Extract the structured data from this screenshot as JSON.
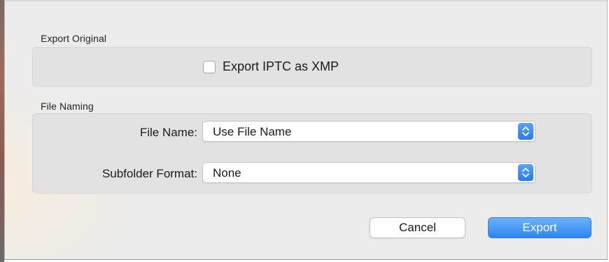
{
  "export_original": {
    "section_title": "Export Original",
    "iptc_checkbox_label": "Export IPTC as XMP",
    "iptc_checked": false
  },
  "file_naming": {
    "section_title": "File Naming",
    "file_name_label": "File Name:",
    "file_name_value": "Use File Name",
    "subfolder_label": "Subfolder Format:",
    "subfolder_value": "None"
  },
  "buttons": {
    "cancel_label": "Cancel",
    "export_label": "Export"
  },
  "icons": {
    "popup_arrows": "up-down-chevron-icon"
  },
  "colors": {
    "accent": "#2f86f2"
  }
}
